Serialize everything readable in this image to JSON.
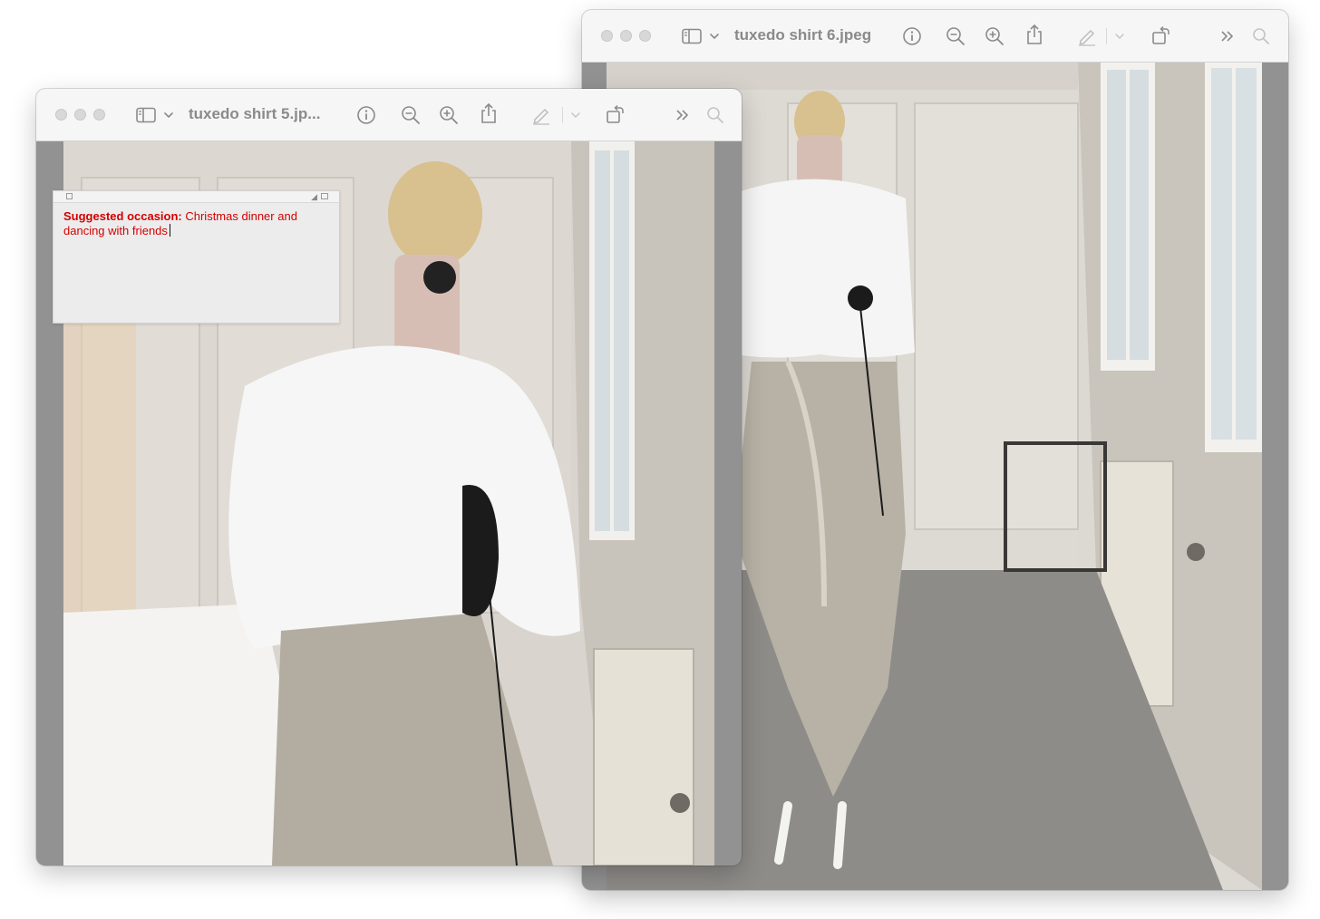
{
  "back_window": {
    "title": "tuxedo shirt 6.jpeg",
    "icons": [
      "sidebar-icon",
      "chevron-down-icon",
      "info-icon",
      "zoom-out-icon",
      "zoom-in-icon",
      "share-icon",
      "markup-pen-icon",
      "chevron-down-icon",
      "rotate-icon",
      "more-icon",
      "search-icon"
    ]
  },
  "front_window": {
    "title": "tuxedo shirt 5.jp...",
    "icons": [
      "sidebar-icon",
      "chevron-down-icon",
      "info-icon",
      "zoom-out-icon",
      "zoom-in-icon",
      "share-icon",
      "markup-pen-icon",
      "chevron-down-icon",
      "rotate-icon",
      "more-icon",
      "search-icon"
    ]
  },
  "note": {
    "label": "Suggested occasion:",
    "text": " Christmas dinner and dancing with friends",
    "text_color": "#d40000"
  },
  "colors": {
    "window_frame": "#929292",
    "toolbar_bg": "#f6f6f6",
    "title_text": "#8a8a8a"
  }
}
